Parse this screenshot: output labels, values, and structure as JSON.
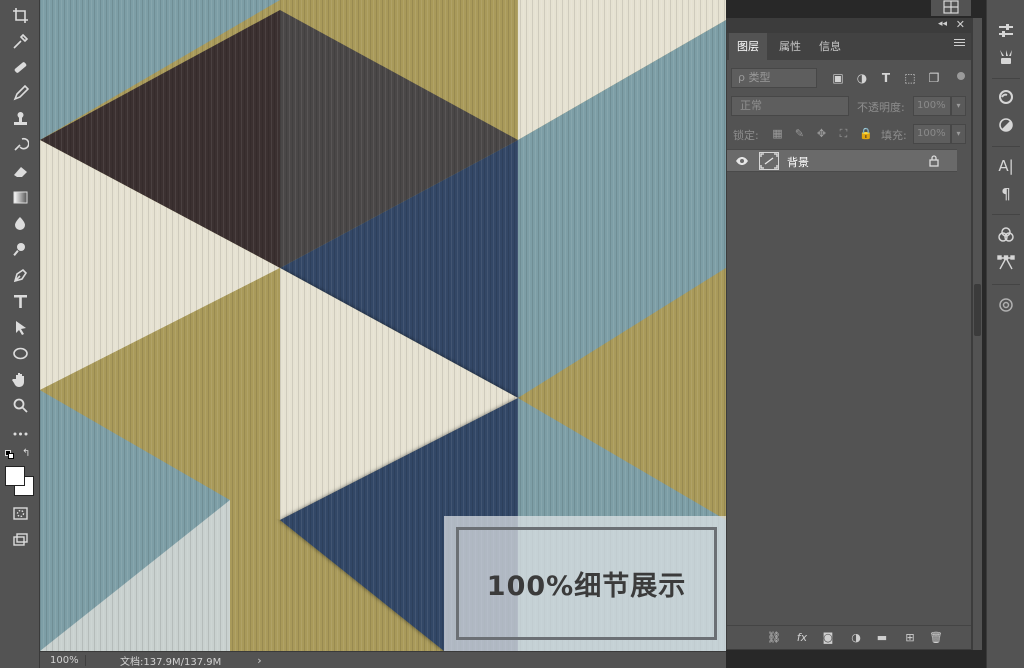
{
  "toolbar": {
    "tools": [
      {
        "name": "crop-icon",
        "glyph": "⌗"
      },
      {
        "name": "eyedropper-icon",
        "glyph": "✎"
      },
      {
        "name": "healing-brush-icon",
        "glyph": "▤"
      },
      {
        "name": "brush-icon",
        "glyph": "✏"
      },
      {
        "name": "clone-stamp-icon",
        "glyph": "♙"
      },
      {
        "name": "history-brush-icon",
        "glyph": "↺"
      },
      {
        "name": "eraser-icon",
        "glyph": "◩"
      },
      {
        "name": "gradient-icon",
        "glyph": "▭"
      },
      {
        "name": "blur-icon",
        "glyph": "💧"
      },
      {
        "name": "dodge-icon",
        "glyph": "●"
      },
      {
        "name": "pen-icon",
        "glyph": "✒"
      },
      {
        "name": "type-icon",
        "glyph": "T"
      },
      {
        "name": "path-selection-icon",
        "glyph": "➤"
      },
      {
        "name": "ellipse-icon",
        "glyph": "○"
      },
      {
        "name": "hand-icon",
        "glyph": "✋"
      },
      {
        "name": "zoom-icon",
        "glyph": "🔍"
      },
      {
        "name": "more-tools-icon",
        "glyph": "•••"
      }
    ]
  },
  "canvas": {
    "overlay_text": "100%细节展示"
  },
  "statusbar": {
    "zoom": "100%",
    "doc_info": "文档:137.9M/137.9M",
    "arrow": "›"
  },
  "panel": {
    "tabs": [
      {
        "label": "图层",
        "active": true
      },
      {
        "label": "属性",
        "active": false
      },
      {
        "label": "信息",
        "active": false
      }
    ],
    "collapse_glyph": "◂◂",
    "close_glyph": "✕",
    "filter": {
      "placeholder": "ρ 类型"
    },
    "blend_mode": "正常",
    "opacity_label": "不透明度:",
    "opacity_value": "100%",
    "lock_label": "锁定:",
    "fill_label": "填充:",
    "fill_value": "100%",
    "layers": [
      {
        "name": "背景",
        "visible": true,
        "locked": true
      }
    ]
  },
  "right_strip": {
    "icons": [
      "adjust-tools-icon",
      "brush-settings-icon",
      "creative-cloud-icon",
      "adjustments-icon",
      "character-icon",
      "paragraph-icon",
      "channels-icon",
      "paths-icon",
      "properties-icon"
    ]
  },
  "colors": {
    "ui_gray": "#535353",
    "ui_dark": "#282828",
    "khaki": "#a99a5a",
    "navy": "#334766",
    "teal": "#7d9ea6",
    "cream": "#e6e2d2",
    "dark_brown": "#3b3030"
  }
}
